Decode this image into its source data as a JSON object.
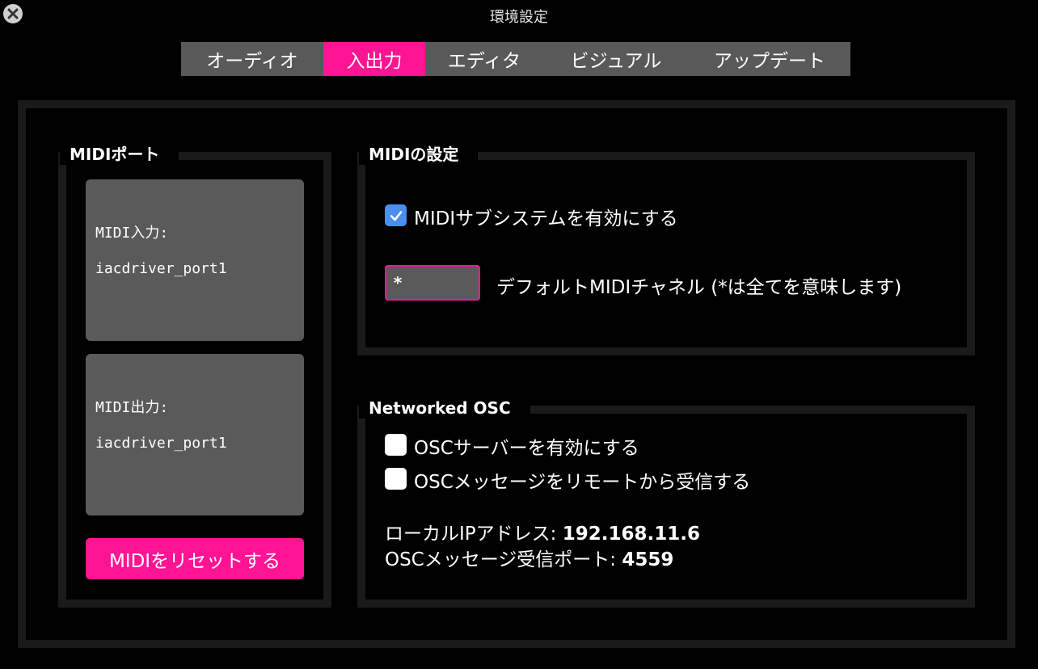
{
  "window": {
    "title": "環境設定",
    "close_icon": "close-x-icon"
  },
  "tabs": [
    {
      "label": "オーディオ",
      "active": false
    },
    {
      "label": "入出力",
      "active": true
    },
    {
      "label": "エディタ",
      "active": false
    },
    {
      "label": "ビジュアル",
      "active": false
    },
    {
      "label": "アップデート",
      "active": false
    }
  ],
  "midi_ports": {
    "title": "MIDIポート",
    "input": {
      "label": "MIDI入力:",
      "value": "iacdriver_port1"
    },
    "output": {
      "label": "MIDI出力:",
      "value": "iacdriver_port1"
    },
    "reset_button": "MIDIをリセットする"
  },
  "midi_settings": {
    "title": "MIDIの設定",
    "enable_label": "MIDIサブシステムを有効にする",
    "enable_checked": true,
    "channel_value": "*",
    "channel_label": "デフォルトMIDIチャネル (*は全てを意味します)"
  },
  "osc": {
    "title": "Networked OSC",
    "server_label": "OSCサーバーを有効にする",
    "server_checked": false,
    "remote_label": "OSCメッセージをリモートから受信する",
    "remote_checked": false,
    "local_ip_label": "ローカルIPアドレス:",
    "local_ip_value": "192.168.11.6",
    "port_label": "OSCメッセージ受信ポート:",
    "port_value": "4559"
  },
  "colors": {
    "accent": "#ff1493",
    "tab_bg": "#595959",
    "panel_bg": "#5a5a5a",
    "frame": "#1a1a1a",
    "checkbox_checked": "#4a8ff0"
  }
}
